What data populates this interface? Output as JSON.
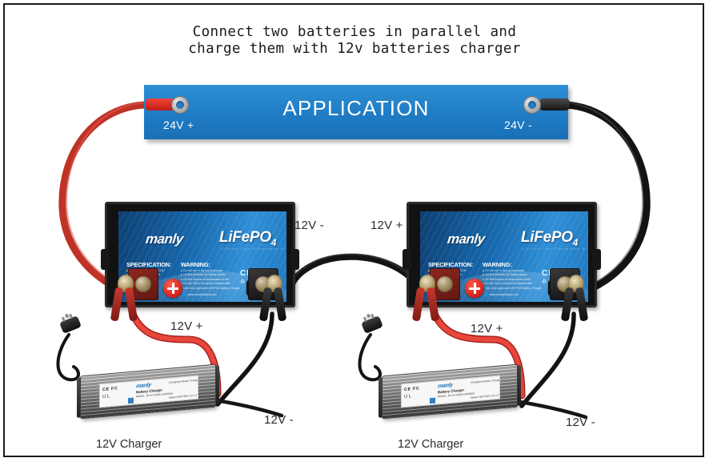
{
  "title": {
    "line1": "Connect two batteries in parallel and",
    "line2": "charge them  with 12v batteries charger"
  },
  "banner": {
    "text": "APPLICATION",
    "positive_label": "24V +",
    "negative_label": "24V -"
  },
  "battery": {
    "brand": "manly",
    "chemistry": "LiFePO",
    "chemistry_sub": "4",
    "chemistry_tagline": "Lithium Iron Phosphate Battery",
    "spec_heading": "SPECIFICATION:",
    "warning_heading": "WARNING:",
    "spec_items": [
      "Model / Number: BL-F12100",
      "Nominal capacity: 100Ah",
      "Nominal voltage: 12.8V",
      "Energy: 1280Wh",
      "Charge voltage: 14.6V"
    ],
    "warning_items": [
      "Do not use in Spring flammable",
      "Do Not immerse by Spring liquids",
      "Do Not Expose at temperature to fire",
      "Do Not Short Circuit and Disassemble",
      "Use Only Approved LiFePO4 Battery Charger"
    ],
    "website": "www.manlybattery.com",
    "cert_ce": "CE",
    "cert_ul": "UL"
  },
  "charger": {
    "brand": "manly",
    "subtitle": "Battery Charger",
    "micro_model": "MODEL: MY-HY14620-1000000A",
    "micro_input": "INPUT: 110V-240V",
    "micro_output": "OUTPUT: DC 14.6V  10.0A   200.0W",
    "micro_right_top": "Charging Indicator\nCharging Red Light\nCharging Finished\nCharging Green Light",
    "micro_right_bottom": "MANLY BATTERY CO.,LTD\nMADE IN CHINA",
    "cert_line1": "CE FC",
    "cert_line2": "UL"
  },
  "labels": {
    "left_battery_negative": "12V -",
    "right_battery_positive": "12V +",
    "left_charger_positive": "12V +",
    "left_charger_negative": "12V -",
    "right_charger_positive": "12V +",
    "right_charger_negative": "12V -",
    "left_charger_caption": "12V Charger",
    "right_charger_caption": "12V Charger"
  },
  "colors": {
    "positive_cable": "#c0392b",
    "negative_cable": "#141414",
    "banner_blue": "#1f7cc4",
    "battery_blue": "#1668ad",
    "frame": "#1a1a1a"
  }
}
